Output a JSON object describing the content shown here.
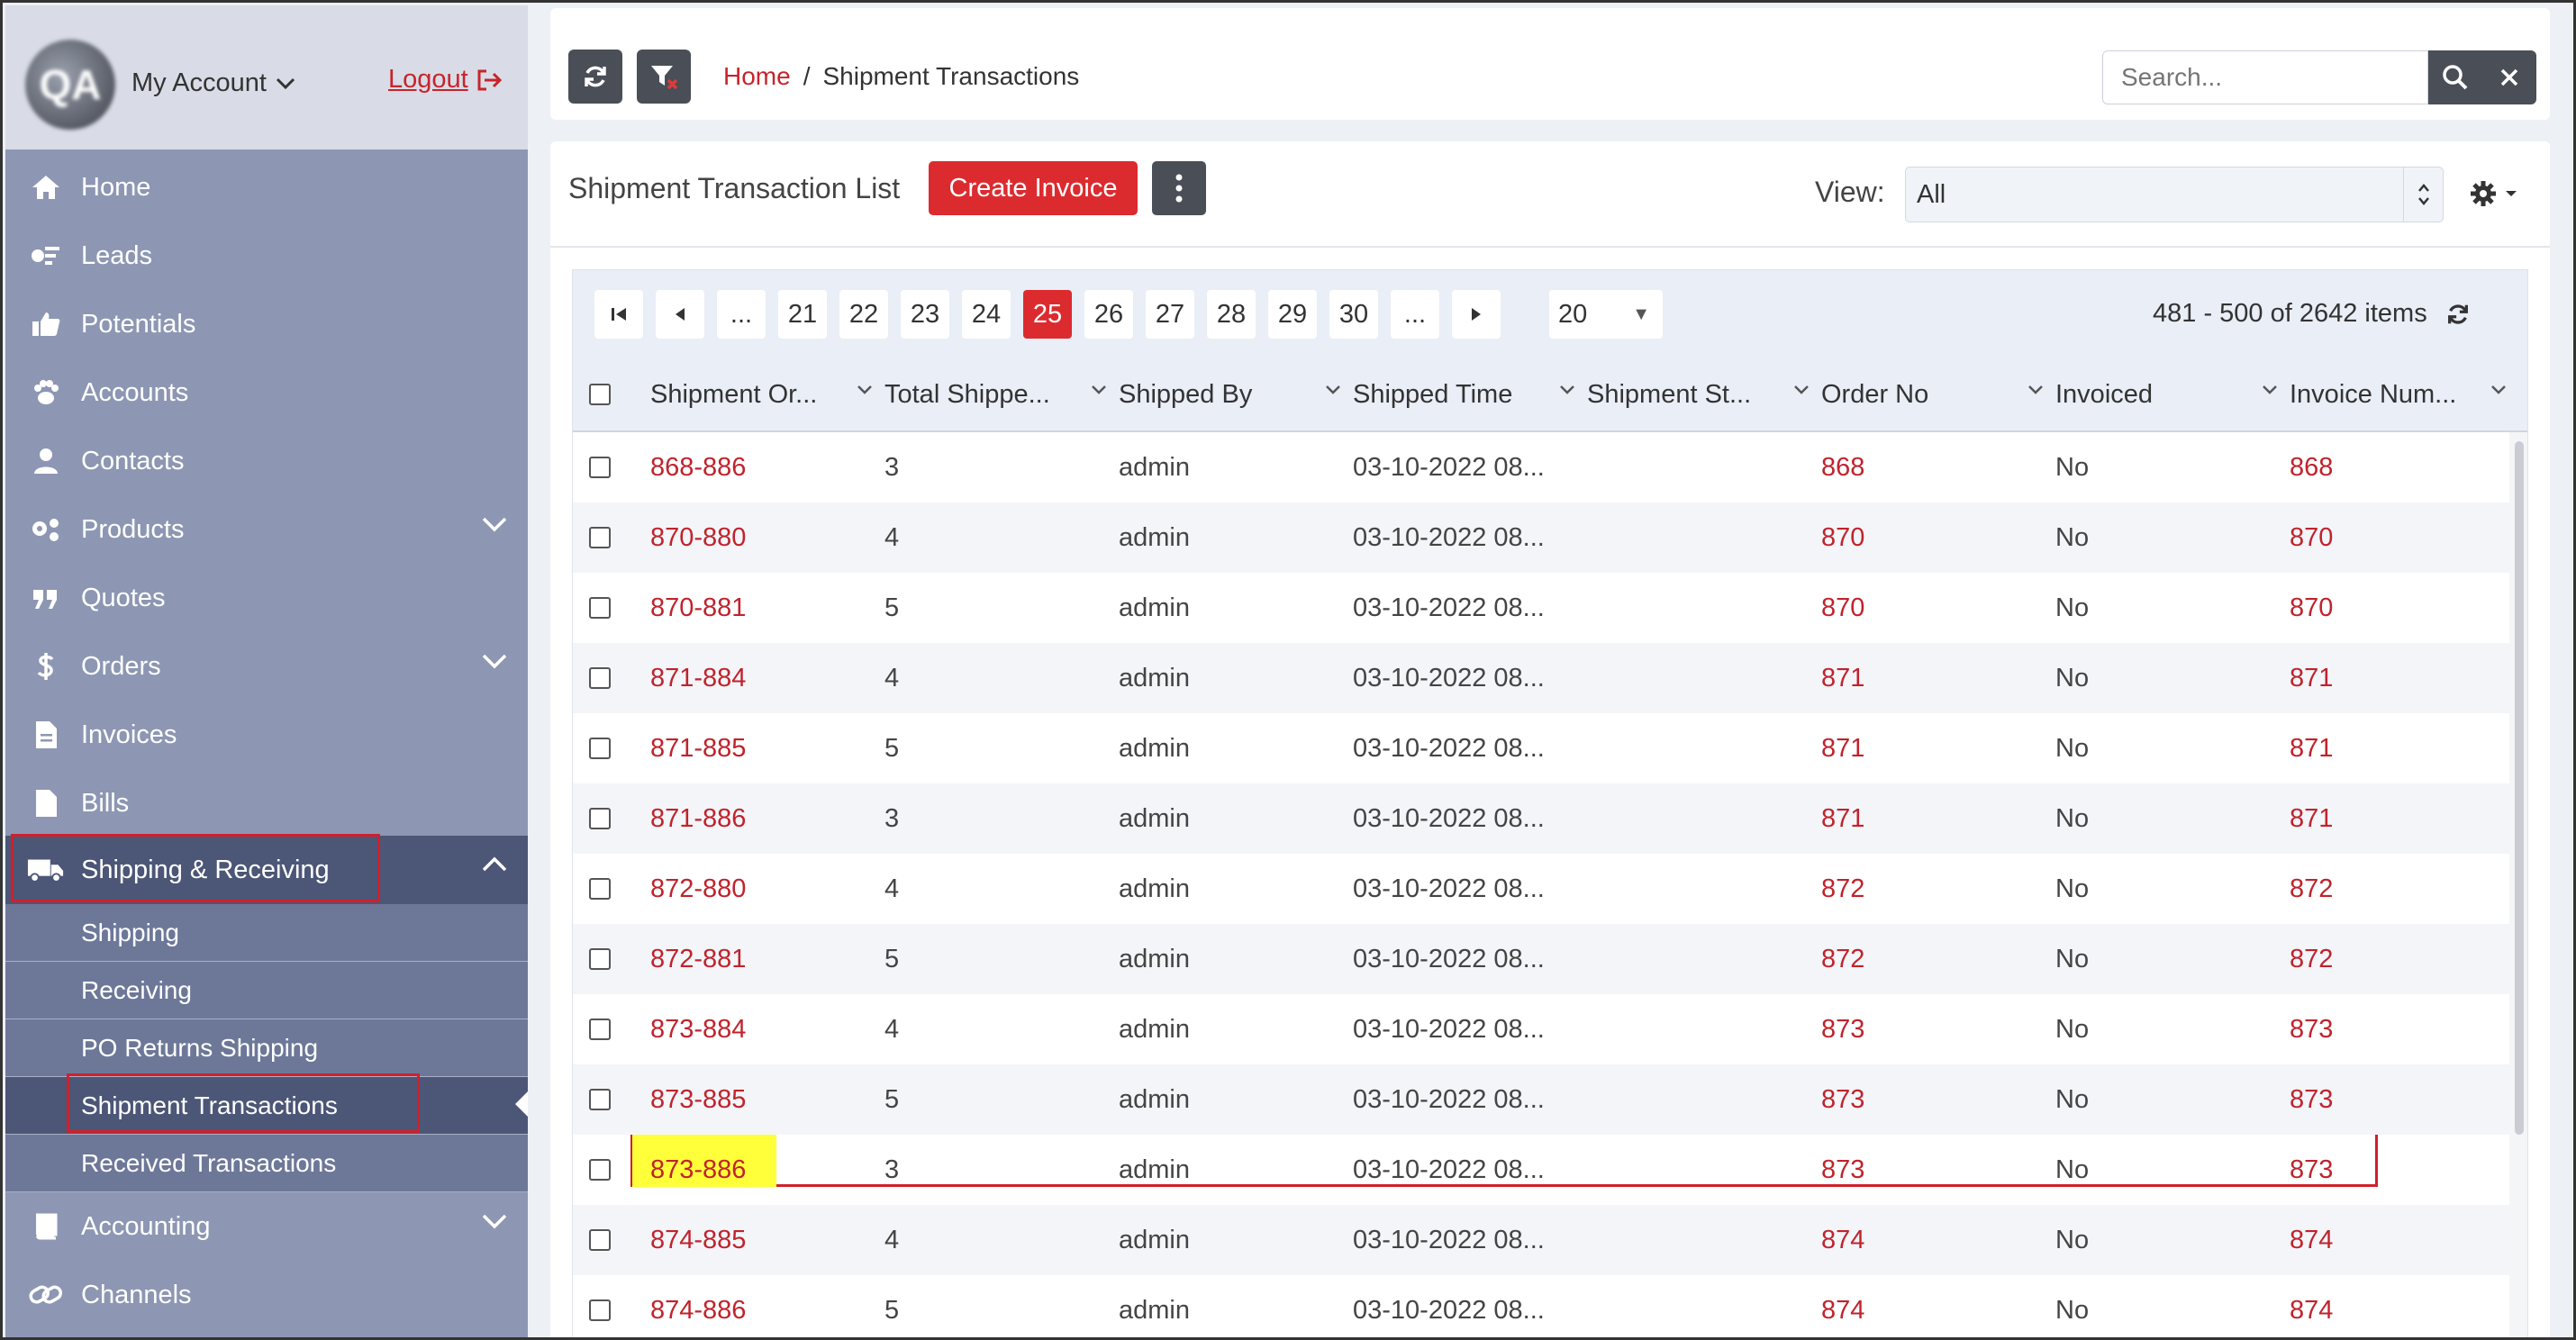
{
  "sidebar": {
    "account_label": "My Account",
    "logout_label": "Logout",
    "items": [
      {
        "label": "Home",
        "icon": "home-icon"
      },
      {
        "label": "Leads",
        "icon": "leads-icon"
      },
      {
        "label": "Potentials",
        "icon": "thumbs-up-icon"
      },
      {
        "label": "Accounts",
        "icon": "paw-icon"
      },
      {
        "label": "Contacts",
        "icon": "user-icon"
      },
      {
        "label": "Products",
        "icon": "gears-icon"
      },
      {
        "label": "Quotes",
        "icon": "quote-icon"
      },
      {
        "label": "Orders",
        "icon": "dollar-icon"
      },
      {
        "label": "Invoices",
        "icon": "file-icon"
      },
      {
        "label": "Bills",
        "icon": "document-icon"
      },
      {
        "label": "Shipping & Receiving",
        "icon": "truck-icon"
      },
      {
        "label": "Accounting",
        "icon": "book-icon"
      },
      {
        "label": "Channels",
        "icon": "link-icon"
      }
    ],
    "submenu": [
      {
        "label": "Shipping"
      },
      {
        "label": "Receiving"
      },
      {
        "label": "PO Returns Shipping"
      },
      {
        "label": "Shipment Transactions"
      },
      {
        "label": "Received Transactions"
      }
    ]
  },
  "topbar": {
    "breadcrumb_home": "Home",
    "breadcrumb_sep": "/",
    "breadcrumb_current": "Shipment Transactions",
    "search_placeholder": "Search..."
  },
  "panel": {
    "title": "Shipment Transaction List",
    "create_invoice_label": "Create Invoice",
    "view_label": "View:",
    "view_value": "All"
  },
  "pager": {
    "ellipsis": "...",
    "pages": [
      "21",
      "22",
      "23",
      "24",
      "25",
      "26",
      "27",
      "28",
      "29",
      "30"
    ],
    "page_size": "20",
    "items_info": "481 - 500 of 2642 items"
  },
  "columns": [
    "Shipment Or...",
    "Total Shippe...",
    "Shipped By",
    "Shipped Time",
    "Shipment St...",
    "Order No",
    "Invoiced",
    "Invoice Num..."
  ],
  "rows": [
    {
      "shipment": "868-886",
      "total": "3",
      "by": "admin",
      "time": "03-10-2022 08...",
      "status": "",
      "order": "868",
      "invoiced": "No",
      "invoice_num": "868"
    },
    {
      "shipment": "870-880",
      "total": "4",
      "by": "admin",
      "time": "03-10-2022 08...",
      "status": "",
      "order": "870",
      "invoiced": "No",
      "invoice_num": "870"
    },
    {
      "shipment": "870-881",
      "total": "5",
      "by": "admin",
      "time": "03-10-2022 08...",
      "status": "",
      "order": "870",
      "invoiced": "No",
      "invoice_num": "870"
    },
    {
      "shipment": "871-884",
      "total": "4",
      "by": "admin",
      "time": "03-10-2022 08...",
      "status": "",
      "order": "871",
      "invoiced": "No",
      "invoice_num": "871"
    },
    {
      "shipment": "871-885",
      "total": "5",
      "by": "admin",
      "time": "03-10-2022 08...",
      "status": "",
      "order": "871",
      "invoiced": "No",
      "invoice_num": "871"
    },
    {
      "shipment": "871-886",
      "total": "3",
      "by": "admin",
      "time": "03-10-2022 08...",
      "status": "",
      "order": "871",
      "invoiced": "No",
      "invoice_num": "871"
    },
    {
      "shipment": "872-880",
      "total": "4",
      "by": "admin",
      "time": "03-10-2022 08...",
      "status": "",
      "order": "872",
      "invoiced": "No",
      "invoice_num": "872"
    },
    {
      "shipment": "872-881",
      "total": "5",
      "by": "admin",
      "time": "03-10-2022 08...",
      "status": "",
      "order": "872",
      "invoiced": "No",
      "invoice_num": "872"
    },
    {
      "shipment": "873-884",
      "total": "4",
      "by": "admin",
      "time": "03-10-2022 08...",
      "status": "",
      "order": "873",
      "invoiced": "No",
      "invoice_num": "873"
    },
    {
      "shipment": "873-885",
      "total": "5",
      "by": "admin",
      "time": "03-10-2022 08...",
      "status": "",
      "order": "873",
      "invoiced": "No",
      "invoice_num": "873"
    },
    {
      "shipment": "873-886",
      "total": "3",
      "by": "admin",
      "time": "03-10-2022 08...",
      "status": "",
      "order": "873",
      "invoiced": "No",
      "invoice_num": "873"
    },
    {
      "shipment": "874-885",
      "total": "4",
      "by": "admin",
      "time": "03-10-2022 08...",
      "status": "",
      "order": "874",
      "invoiced": "No",
      "invoice_num": "874"
    },
    {
      "shipment": "874-886",
      "total": "5",
      "by": "admin",
      "time": "03-10-2022 08...",
      "status": "",
      "order": "874",
      "invoiced": "No",
      "invoice_num": "874"
    }
  ],
  "colors": {
    "accent_red": "#dc2b2f",
    "sidebar_bg": "#8d97b3",
    "sidebar_active": "#4c5677",
    "highlight_yellow": "#ffff3a"
  }
}
